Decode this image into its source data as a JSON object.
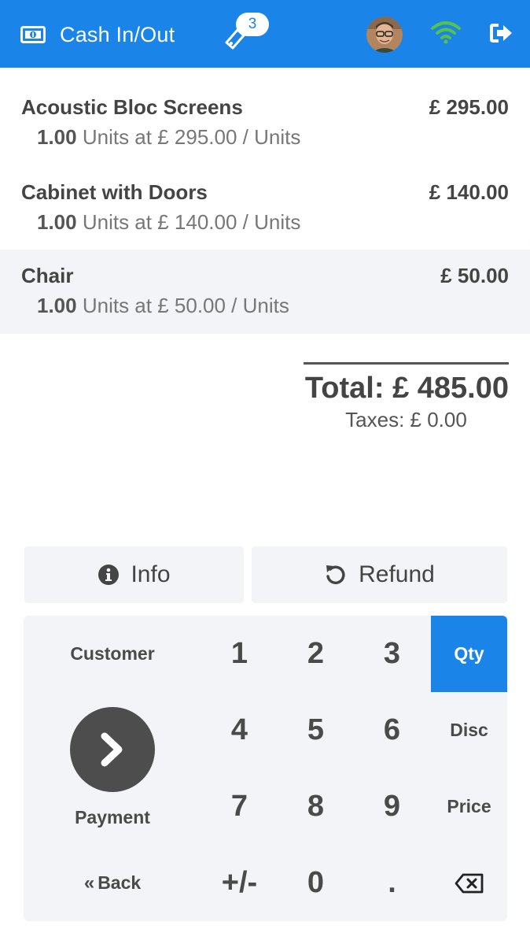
{
  "header": {
    "cash_label": "Cash In/Out",
    "tickets_count": "3",
    "colors": {
      "bar": "#1a84e9",
      "wifi": "#57c24a"
    }
  },
  "orderlines": [
    {
      "name": "Acoustic Bloc Screens",
      "price": "£ 295.00",
      "qty": "1.00",
      "detail": "Units at £ 295.00 / Units",
      "selected": false
    },
    {
      "name": "Cabinet with Doors",
      "price": "£ 140.00",
      "qty": "1.00",
      "detail": "Units at £ 140.00 / Units",
      "selected": false
    },
    {
      "name": "Chair",
      "price": "£ 50.00",
      "qty": "1.00",
      "detail": "Units at £ 50.00 / Units",
      "selected": true
    }
  ],
  "summary": {
    "total": "Total: £ 485.00",
    "taxes": "Taxes: £ 0.00"
  },
  "controls": {
    "info_label": "Info",
    "refund_label": "Refund"
  },
  "keypad": {
    "customer_label": "Customer",
    "payment_label": "Payment",
    "back_label": "Back",
    "back_prefix": "«",
    "keys": [
      "1",
      "2",
      "3",
      "4",
      "5",
      "6",
      "7",
      "8",
      "9",
      "+/-",
      "0",
      "."
    ],
    "modes": [
      "Qty",
      "Disc",
      "Price"
    ],
    "active_mode": "Qty"
  }
}
